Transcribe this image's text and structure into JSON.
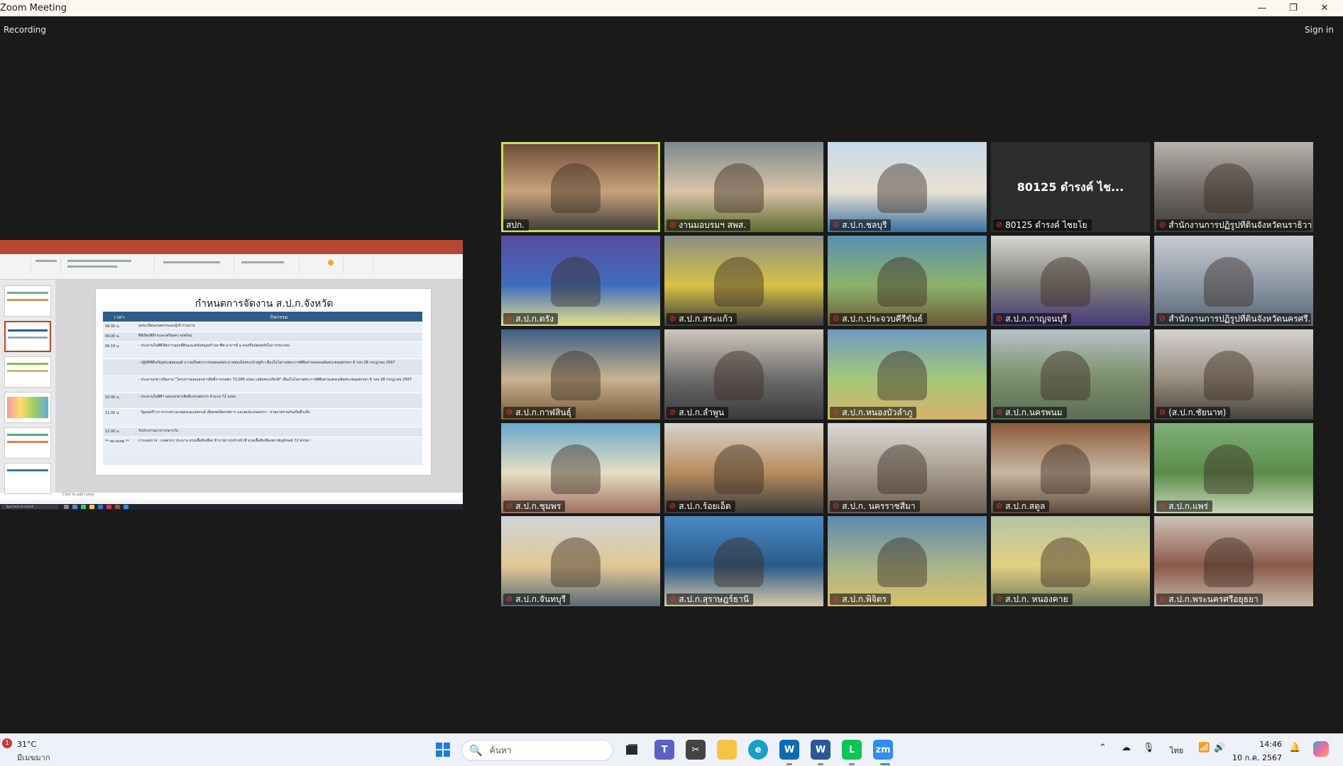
{
  "window": {
    "title": "Zoom Meeting",
    "min": "—",
    "max": "❐",
    "close": "✕"
  },
  "topbar": {
    "recording": "Recording",
    "sign_in": "Sign in"
  },
  "share": {
    "slide_title": "กำหนดการจัดงาน ส.ป.ก.จังหวัด",
    "col_time": "เวลา",
    "col_activity": "กิจกรรม",
    "notes": "Click to add notes",
    "taskbar_search": "Type here to search",
    "rows": [
      {
        "time": "08.00 น.",
        "activity": "ลงทะเบียนเกษตรกรและผู้เข้าร่วมงาน"
      },
      {
        "time": "09.00 น.",
        "activity": "พิธีเปิด/พิธีกรและเตรียมความพร้อม"
      },
      {
        "time": "09.19 น.",
        "activity": "- ประธานในพิธีเปิดการมอบที่ดินและสนับสนุนสร้างอาชีพ อาจารย์ ๑ คนหรือปลอดภัยในการประกอบ"
      },
      {
        "time": "",
        "activity": "- ปฏิบัติพิธีเจริญพระพุทธมนต์ ถวายเป็นพระราชกุศลแด่พระบาทสมเด็จพระเจ้าอยู่หัว เนื่องในโอกาสพระราชพิธีมหามงคลเฉลิมพระชนมพรรษา 6 รอบ 28 กรกฎาคม 2567"
      },
      {
        "time": "",
        "activity": "- ประธานกล่าวเปิดงาน \"โครงการมอบเอกสารสิทธิ์การเกษตร 72,000 แปลง เฉลิมพระเกียรติ\" เนื่องในโอกาสพระราชพิธีมหามงคลเฉลิมพระชนมพรรษา 6 รอบ 28 กรกฎาคม 2567"
      },
      {
        "time": "10.00 น.",
        "activity": "- ประธานในพิธีฯ มอบเอกสารสิทธิ์แก่เกษตรกร จำนวน 72 แปลง"
      },
      {
        "time": "11.00 น.",
        "activity": "- รัฐมนตรีว่าการกระทรวงเกษตรและสหกรณ์ เยี่ยมชมนิทรรศการ และพบปะเกษตรกร - ถ่ายภาพร่วมกันเป็นที่ระลึก"
      },
      {
        "time": "12.00 น.",
        "activity": "รับประทานอาหารกลางวัน"
      },
      {
        "time": "** หมายเหตุ **",
        "activity": "การแต่งกาย : เกษตรกร ประธาน สวมเสื้อสีเหลือง ข้าราชการ/เจ้าหน้าที่ สวมเสื้อสีเหลืองตราสัญลักษณ์ 72 พรรษา"
      }
    ]
  },
  "tiles": [
    {
      "label": "สปก.",
      "muted": false,
      "active": true
    },
    {
      "label": "งานมอบรมฯ สพส.",
      "muted": true
    },
    {
      "label": "ส.ป.ก.ชลบุรี",
      "muted": true
    },
    {
      "label": "80125 ดำรงค์ ไชยโย",
      "muted": true,
      "big_name": "80125 ดำรงค์ ไช..."
    },
    {
      "label": "สำนักงานการปฏิรูปที่ดินจังหวัดนราธิวาส",
      "muted": true
    },
    {
      "label": "ส.ป.ก.ตรัง",
      "muted": true
    },
    {
      "label": "ส.ป.ก.สระแก้ว",
      "muted": true
    },
    {
      "label": "ส.ป.ก.ประจวบคีรีขันธ์",
      "muted": true
    },
    {
      "label": "ส.ป.ก.กาญจนบุรี",
      "muted": true
    },
    {
      "label": "สำนักงานการปฏิรูปที่ดินจังหวัดนครศรี...",
      "muted": true
    },
    {
      "label": "ส.ป.ก.กาฬสินธุ์",
      "muted": true
    },
    {
      "label": "ส.ป.ก.ลำพูน",
      "muted": true
    },
    {
      "label": "ส.ป.ก.หนองบัวลำภู",
      "muted": true
    },
    {
      "label": "ส.ป.ก.นครพนม",
      "muted": true
    },
    {
      "label": "(ส.ป.ก.ชัยนาท)",
      "muted": true
    },
    {
      "label": "ส.ป.ก.ชุมพร",
      "muted": true
    },
    {
      "label": "ส.ป.ก.ร้อยเอ็ด",
      "muted": true
    },
    {
      "label": "ส.ป.ก. นครราชสีมา",
      "muted": true
    },
    {
      "label": "ส.ป.ก.สตูล",
      "muted": true
    },
    {
      "label": "ส.ป.ก.แพร่",
      "muted": true
    },
    {
      "label": "ส.ป.ก.จันทบุรี",
      "muted": true
    },
    {
      "label": "ส.ป.ก.สุราษฎร์ธานี",
      "muted": true
    },
    {
      "label": "ส.ป.ก.พิจิตร",
      "muted": true
    },
    {
      "label": "ส.ป.ก. หนองคาย",
      "muted": true
    },
    {
      "label": "ส.ป.ก.พระนครศรีอยุธยา",
      "muted": true
    }
  ],
  "taskbar": {
    "weather_badge": "1",
    "temperature": "31°C",
    "weather_desc": "มีเมฆมาก",
    "search_placeholder": "ค้นหา",
    "search_icon": "🔍",
    "language": "ไทย",
    "time": "14:46",
    "date": "10 ก.ค. 2567",
    "tray_chevron": "⌃",
    "tray_mic": "🎙",
    "tray_wifi": "📶",
    "tray_volume": "🔊",
    "tray_bell": "🔔"
  },
  "colors": {
    "active_outline": "#c9e05a",
    "ppt_accent": "#b7472a",
    "table_head": "#2f5d8a"
  }
}
